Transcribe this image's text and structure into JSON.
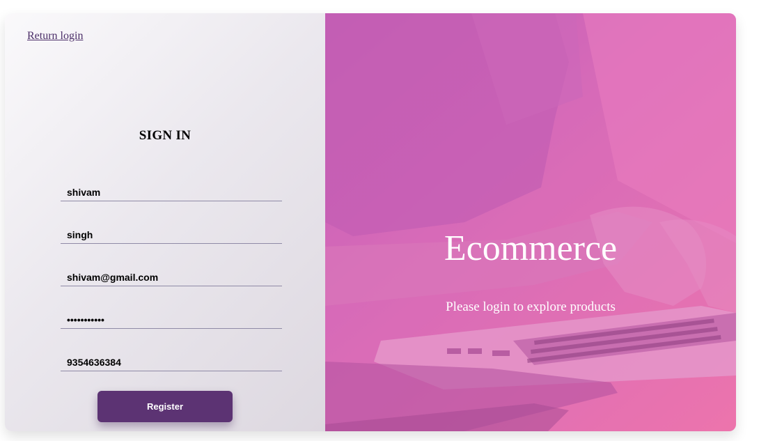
{
  "nav": {
    "return_login": "Return login"
  },
  "form": {
    "title": "SIGN IN",
    "first_name": "shivam",
    "last_name": "singh",
    "email": "shivam@gmail.com",
    "password": "•••••••••••",
    "phone": "9354636384",
    "register_label": "Register"
  },
  "hero": {
    "title": "Ecommerce",
    "subtitle": "Please login to explore products"
  },
  "colors": {
    "accent": "#5c3373",
    "hero_overlay": "#d46db6"
  }
}
